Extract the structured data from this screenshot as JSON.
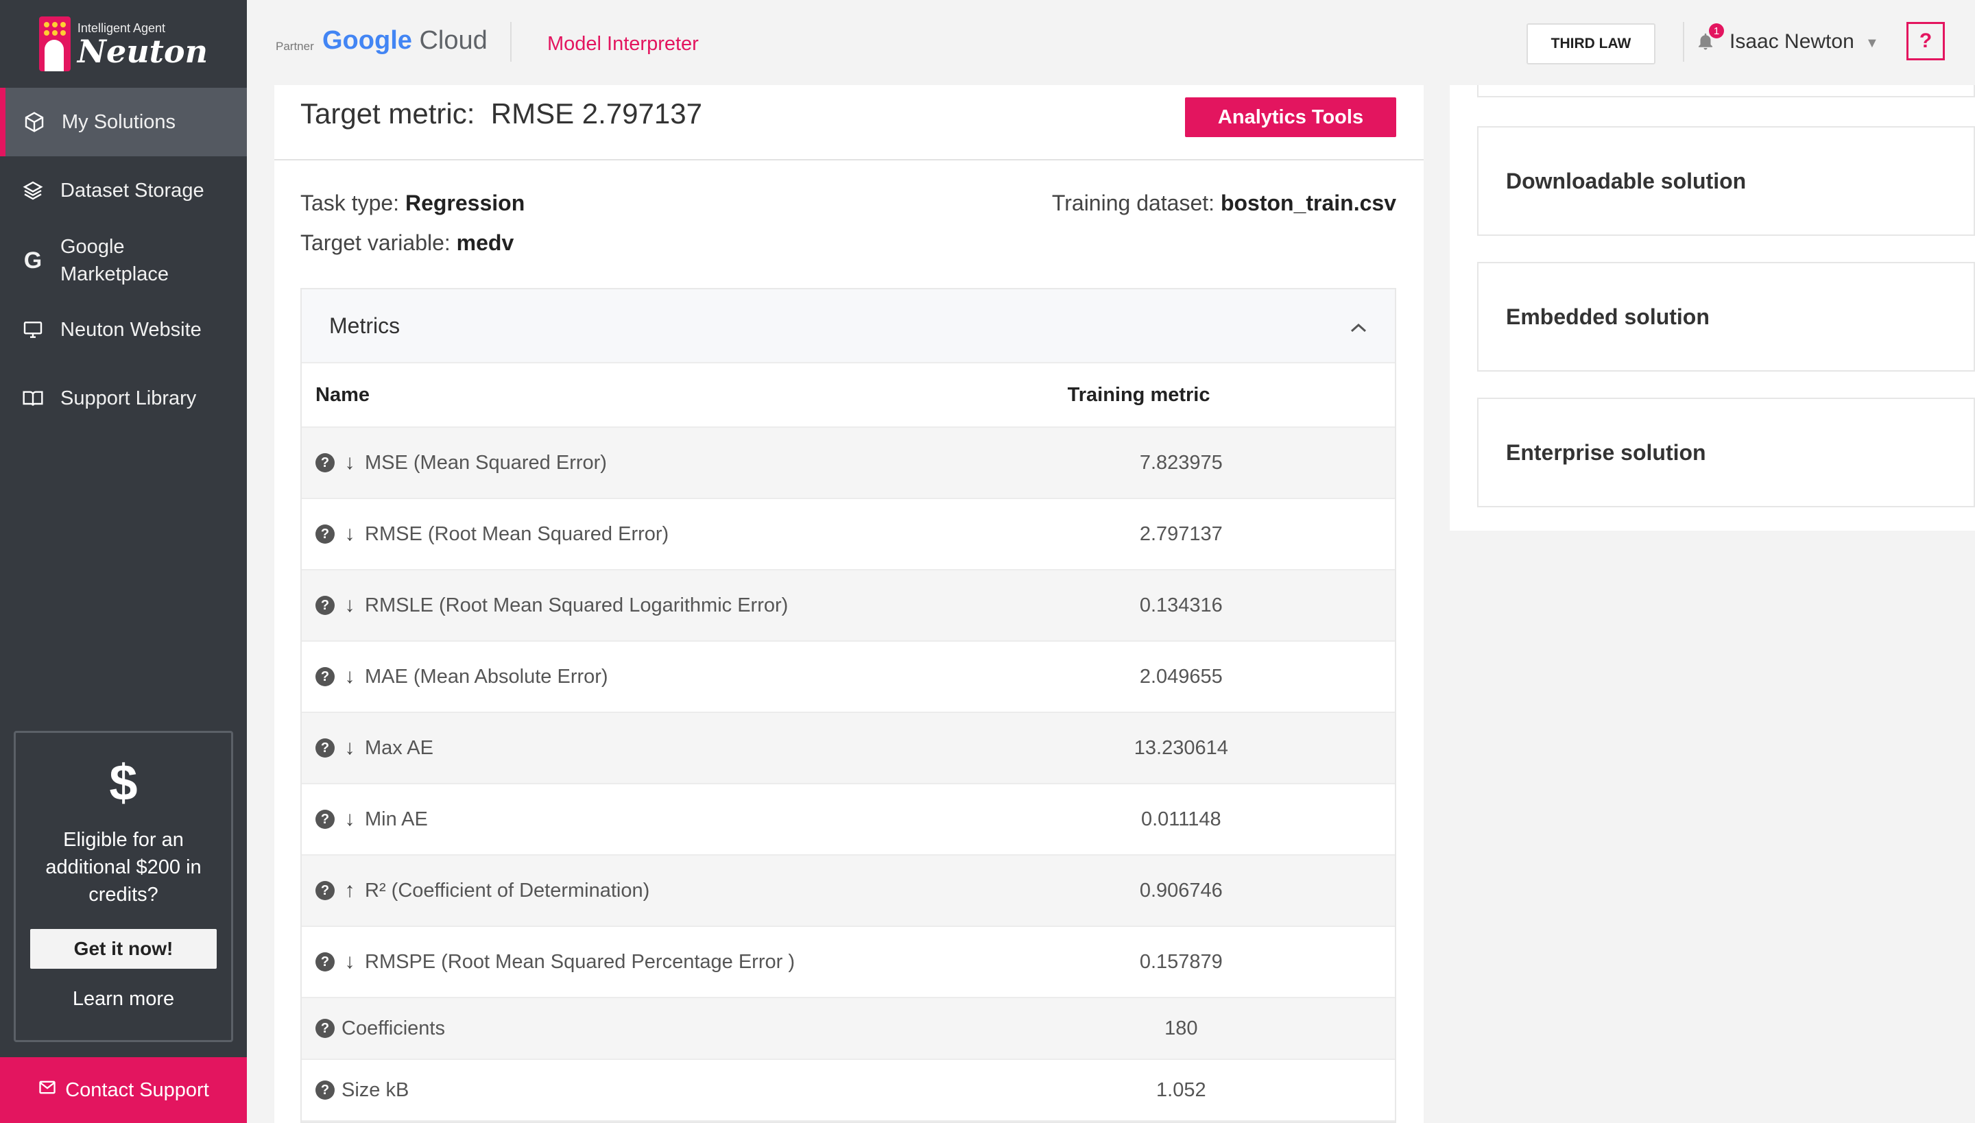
{
  "brand": {
    "subtitle": "Intelligent Agent",
    "name": "Neuton"
  },
  "sidebar": {
    "items": [
      {
        "label": "My Solutions",
        "icon": "cube-icon"
      },
      {
        "label": "Dataset Storage",
        "icon": "layers-icon"
      },
      {
        "label": "Google Marketplace",
        "icon": "google-icon"
      },
      {
        "label": "Neuton Website",
        "icon": "monitor-icon"
      },
      {
        "label": "Support Library",
        "icon": "book-icon"
      }
    ],
    "promo": {
      "symbol": "$",
      "text": "Eligible for an additional $200 in credits?",
      "button": "Get it now!",
      "link": "Learn more"
    },
    "contact": "Contact Support"
  },
  "header": {
    "partner": "Partner",
    "cloud_brand": "Google",
    "cloud_word": "Cloud",
    "section": "Model Interpreter",
    "workspace_button": "THIRD LAW",
    "notifications": "1",
    "user": "Isaac Newton",
    "help": "?"
  },
  "main": {
    "target_label": "Target metric:",
    "target_value": "RMSE 2.797137",
    "analytics_button": "Analytics Tools",
    "task_type_label": "Task type:",
    "task_type": "Regression",
    "target_variable_label": "Target variable:",
    "target_variable": "medv",
    "training_dataset_label": "Training dataset:",
    "training_dataset": "boston_train.csv",
    "metrics": {
      "title": "Metrics",
      "col_name": "Name",
      "col_metric": "Training metric",
      "rows": [
        {
          "arrow": "↓",
          "name": "MSE (Mean Squared Error)",
          "value": "7.823975"
        },
        {
          "arrow": "↓",
          "name": "RMSE (Root Mean Squared Error)",
          "value": "2.797137"
        },
        {
          "arrow": "↓",
          "name": "RMSLE (Root Mean Squared Logarithmic Error)",
          "value": "0.134316"
        },
        {
          "arrow": "↓",
          "name": "MAE (Mean Absolute Error)",
          "value": "2.049655"
        },
        {
          "arrow": "↓",
          "name": "Max AE",
          "value": "13.230614"
        },
        {
          "arrow": "↓",
          "name": "Min AE",
          "value": "0.011148"
        },
        {
          "arrow": "↑",
          "name": "R² (Coefficient of Determination)",
          "value": "0.906746"
        },
        {
          "arrow": "↓",
          "name": "RMSPE (Root Mean Squared Percentage Error )",
          "value": "0.157879"
        },
        {
          "arrow": "",
          "name": "Coefficients",
          "value": "180"
        },
        {
          "arrow": "",
          "name": "Size kB",
          "value": "1.052"
        }
      ]
    }
  },
  "right_panel": {
    "solutions": [
      "Downloadable solution",
      "Embedded solution",
      "Enterprise solution"
    ]
  },
  "colors": {
    "accent": "#e3155f",
    "sidebar_bg": "#363a40"
  }
}
